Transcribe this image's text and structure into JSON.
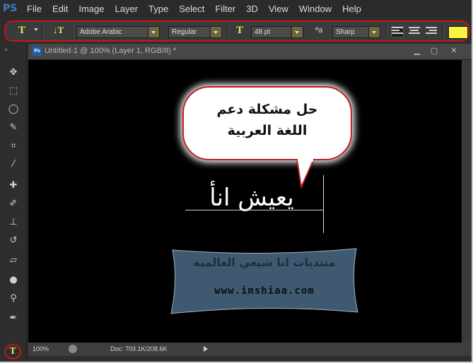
{
  "app": {
    "logo": "PS"
  },
  "menu": [
    "File",
    "Edit",
    "Image",
    "Layer",
    "Type",
    "Select",
    "Filter",
    "3D",
    "View",
    "Window",
    "Help"
  ],
  "options": {
    "font_family": "Adobe Arabic",
    "font_style": "Regular",
    "font_size": "48 pt",
    "antialias_label": "ªa",
    "antialias": "Sharp",
    "text_color": "#f5f542"
  },
  "document": {
    "badge": "Ps",
    "title": "Untitled-1 @ 100% (Layer 1, RGB/8) *"
  },
  "canvas": {
    "bubble_line1": "حل مشكلة دعم",
    "bubble_line2": "اللغة العربية",
    "typed_text": "يعيش انأ",
    "banner_arabic": "منتديات انا شيعي العالمية",
    "banner_url": "www.imshiaa.com"
  },
  "status": {
    "zoom": "100%",
    "doc": "Doc: 703.1K/208.6K"
  },
  "colors": {
    "highlight": "#c71616",
    "accent_text": "#e6e35a",
    "banner_fill": "#3f5a70"
  },
  "icons": {
    "toolbox": [
      "move-icon",
      "marquee-icon",
      "lasso-icon",
      "quick-select-icon",
      "crop-icon",
      "eyedropper-icon",
      "healing-icon",
      "brush-icon",
      "stamp-icon",
      "history-brush-icon",
      "eraser-icon",
      "blur-icon",
      "dodge-icon",
      "pen-icon"
    ]
  }
}
